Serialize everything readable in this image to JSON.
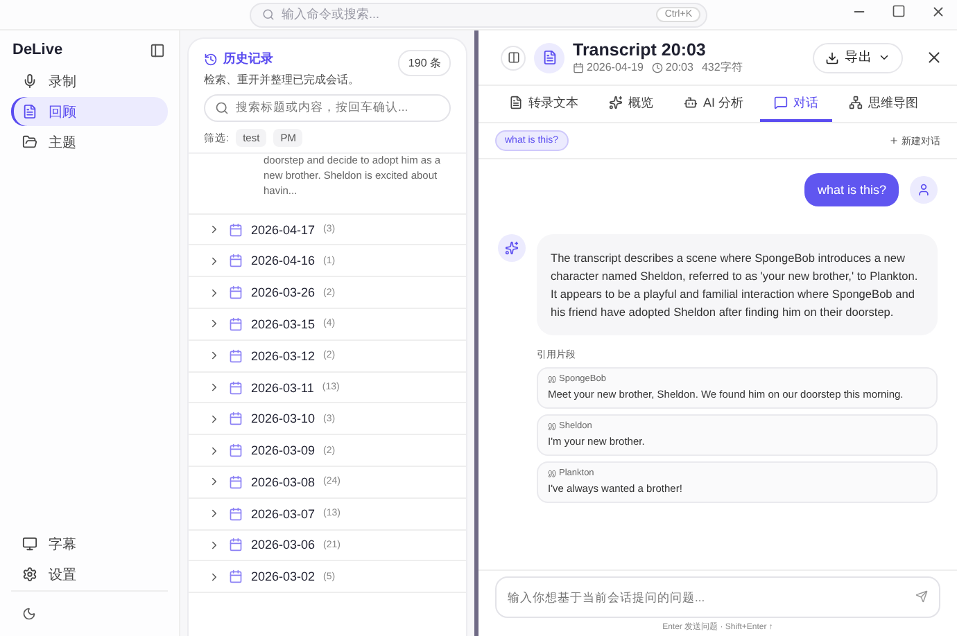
{
  "command_bar": {
    "placeholder": "输入命令或搜索...",
    "shortcut": "Ctrl+K"
  },
  "sidebar": {
    "app_name": "DeLive",
    "items": [
      {
        "label": "录制",
        "selected": false
      },
      {
        "label": "回顾",
        "selected": true
      },
      {
        "label": "主题",
        "selected": false
      }
    ],
    "bottom_items": [
      {
        "label": "字幕"
      },
      {
        "label": "设置"
      }
    ]
  },
  "history": {
    "title": "历史记录",
    "subtitle": "检索、重开并整理已完成会话。",
    "count": "190 条",
    "search_placeholder": "搜索标题或内容，按回车确认...",
    "filter_label": "筛选:",
    "filters": [
      "test",
      "PM"
    ],
    "preview_text": "doorstep and decide to adopt him as a new brother. Sheldon is excited about havin...",
    "groups": [
      {
        "date": "2026-04-17",
        "count": "(3)",
        "expanded": false
      },
      {
        "date": "2026-04-16",
        "count": "(1)",
        "expanded": false
      },
      {
        "date": "2026-03-26",
        "count": "(2)",
        "expanded": false
      },
      {
        "date": "2026-03-15",
        "count": "(4)",
        "expanded": false
      },
      {
        "date": "2026-03-12",
        "count": "(2)",
        "expanded": false
      },
      {
        "date": "2026-03-11",
        "count": "(13)",
        "expanded": false
      },
      {
        "date": "2026-03-10",
        "count": "(3)",
        "expanded": false
      },
      {
        "date": "2026-03-09",
        "count": "(2)",
        "expanded": false
      },
      {
        "date": "2026-03-08",
        "count": "(24)",
        "expanded": false
      },
      {
        "date": "2026-03-07",
        "count": "(13)",
        "expanded": false
      },
      {
        "date": "2026-03-06",
        "count": "(21)",
        "expanded": false
      },
      {
        "date": "2026-03-02",
        "count": "(5)",
        "expanded": false
      }
    ]
  },
  "transcript": {
    "title": "Transcript 20:03",
    "date": "2026-04-19",
    "time": "20:03",
    "chars": "432字符",
    "export_label": "导出",
    "tabs": [
      {
        "label": "转录文本",
        "selected": false
      },
      {
        "label": "概览",
        "selected": false
      },
      {
        "label": "AI 分析",
        "selected": false
      },
      {
        "label": "对话",
        "selected": true
      },
      {
        "label": "思维导图",
        "selected": false
      }
    ],
    "conversations": [
      {
        "label": "what is this?",
        "selected": true
      }
    ],
    "new_chat_label": "新建对话",
    "user_message": "what is this?",
    "assistant_message": "The transcript describes a scene where SpongeBob introduces a new character named Sheldon, referred to as 'your new brother,' to Plankton. It appears to be a playful and familial interaction where SpongeBob and his friend have adopted Sheldon after finding him on their doorstep.",
    "citations_title": "引用片段",
    "citations": [
      {
        "speaker": "SpongeBob",
        "text": "Meet your new brother, Sheldon. We found him on our doorstep this morning."
      },
      {
        "speaker": "Sheldon",
        "text": "I'm your new brother."
      },
      {
        "speaker": "Plankton",
        "text": "I've always wanted a brother!"
      }
    ],
    "input_placeholder": "输入你想基于当前会话提问的问题...",
    "hint": "Enter 发送问题 · Shift+Enter ↑"
  }
}
